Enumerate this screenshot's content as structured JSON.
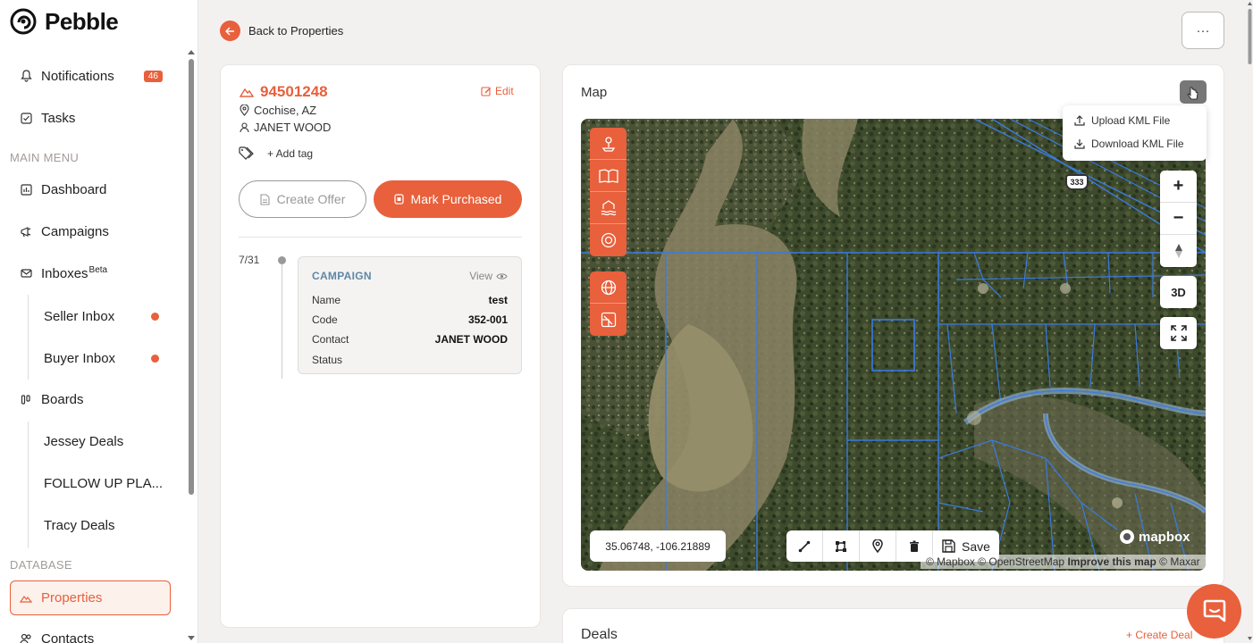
{
  "app": {
    "name": "Pebble"
  },
  "colors": {
    "accent": "#e8603c",
    "campaign": "#5f87a6",
    "parcel_lines": "#3a7be0"
  },
  "sidebar": {
    "notifications": {
      "label": "Notifications",
      "badge": "46"
    },
    "tasks": {
      "label": "Tasks"
    },
    "main_menu_header": "MAIN MENU",
    "dashboard": {
      "label": "Dashboard"
    },
    "campaigns": {
      "label": "Campaigns"
    },
    "inboxes": {
      "label": "Inboxes",
      "sup": "Beta"
    },
    "seller_inbox": {
      "label": "Seller Inbox"
    },
    "buyer_inbox": {
      "label": "Buyer Inbox"
    },
    "boards": {
      "label": "Boards"
    },
    "board_items": [
      "Jessey Deals",
      "FOLLOW UP PLA...",
      "Tracy Deals"
    ],
    "database_header": "DATABASE",
    "properties": {
      "label": "Properties"
    },
    "contacts": {
      "label": "Contacts"
    }
  },
  "header": {
    "back_label": "Back to Properties",
    "more_label": "···"
  },
  "property": {
    "id": "94501248",
    "edit_label": "Edit",
    "location": "Cochise, AZ",
    "owner": "JANET WOOD",
    "add_tag_label": "+ Add tag",
    "create_offer_label": "Create Offer",
    "mark_purchased_label": "Mark Purchased"
  },
  "timeline": {
    "date": "7/31",
    "campaign": {
      "title": "CAMPAIGN",
      "view_label": "View",
      "rows": [
        {
          "label": "Name",
          "value": "test"
        },
        {
          "label": "Code",
          "value": "352-001"
        },
        {
          "label": "Contact",
          "value": "JANET WOOD"
        },
        {
          "label": "Status",
          "value": ""
        }
      ]
    }
  },
  "map": {
    "title": "Map",
    "menu": {
      "upload_label": "Upload KML File",
      "download_label": "Download KML File"
    },
    "coords": "35.06748, -106.21889",
    "save_label": "Save",
    "view_3d_label": "3D",
    "road_shield": "333",
    "mapbox_label": "mapbox",
    "attribution": {
      "text1": "© Mapbox © OpenStreetMap",
      "improve": "Improve this map",
      "text2": "© Maxar"
    }
  },
  "deals": {
    "title": "Deals",
    "create_label": "+ Create Deal"
  }
}
